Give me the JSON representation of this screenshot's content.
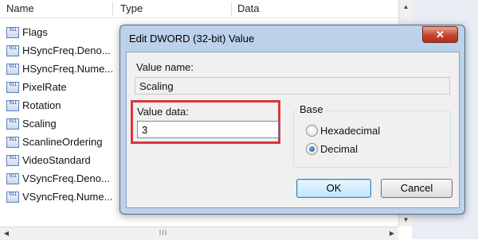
{
  "list": {
    "columns": [
      "Name",
      "Type",
      "Data"
    ],
    "icon": "registry-binary-value-icon",
    "icon_text": "011",
    "items": [
      "Flags",
      "HSyncFreq.Deno...",
      "HSyncFreq.Nume...",
      "PixelRate",
      "Rotation",
      "Scaling",
      "ScanlineOrdering",
      "VideoStandard",
      "VSyncFreq.Deno...",
      "VSyncFreq.Nume..."
    ],
    "scroll_up_glyph": "▲",
    "scroll_down_glyph": "▼",
    "scroll_left_glyph": "◀",
    "scroll_right_glyph": "▶",
    "scroll_grip_glyph": "III"
  },
  "dialog": {
    "title": "Edit DWORD (32-bit) Value",
    "close_glyph": "✕",
    "value_name_label": "Value name:",
    "value_name": "Scaling",
    "value_data_label": "Value data:",
    "value_data": "3",
    "base_label": "Base",
    "base_options": [
      {
        "label": "Hexadecimal",
        "selected": false
      },
      {
        "label": "Decimal",
        "selected": true
      }
    ],
    "ok_label": "OK",
    "cancel_label": "Cancel"
  },
  "colors": {
    "highlight": "#d9363e",
    "dialog_frame": "#bcd1ea",
    "close_button": "#c4442a"
  }
}
